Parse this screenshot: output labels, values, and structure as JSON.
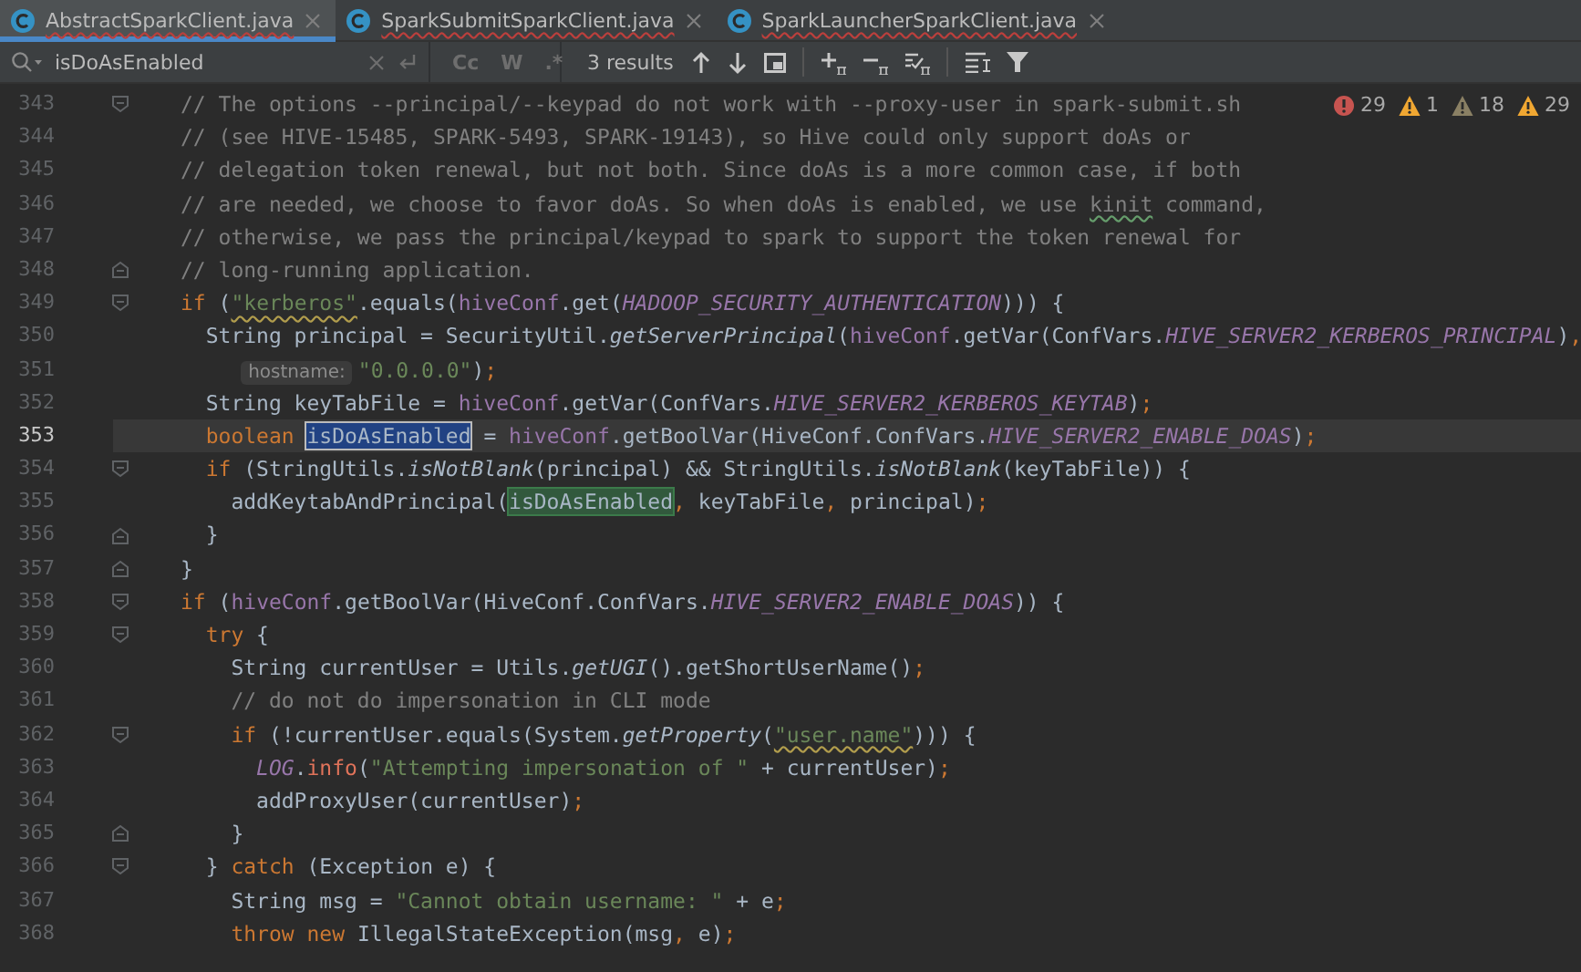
{
  "tabs": [
    {
      "label": "AbstractSparkClient.java",
      "selected": true
    },
    {
      "label": "SparkSubmitSparkClient.java",
      "selected": false
    },
    {
      "label": "SparkLauncherSparkClient.java",
      "selected": false
    }
  ],
  "search": {
    "value": "isDoAsEnabled",
    "options": [
      {
        "label": "Cc",
        "selected": false
      },
      {
        "label": "W",
        "selected": false
      },
      {
        "label": ".*",
        "selected": false
      }
    ],
    "results": "3 results"
  },
  "inspections": [
    {
      "kind": "error",
      "count": "29"
    },
    {
      "kind": "warning",
      "count": "1"
    },
    {
      "kind": "weak",
      "count": "18"
    },
    {
      "kind": "warning",
      "count": "29"
    }
  ],
  "lines": [
    {
      "number": "343",
      "kind": "fold-start",
      "current": false,
      "tokens": [
        {
          "kind": "comment",
          "text": "// The options --principal/--keypad do not work with --proxy-user in spark-submit.sh"
        }
      ]
    },
    {
      "number": "344",
      "kind": "code",
      "current": false,
      "tokens": [
        {
          "kind": "comment",
          "text": "// (see HIVE-15485, SPARK-5493, SPARK-19143), so Hive could only support doAs or"
        }
      ]
    },
    {
      "number": "345",
      "kind": "code",
      "current": false,
      "tokens": [
        {
          "kind": "comment",
          "text": "// delegation token renewal, but not both. Since doAs is a more common case, if both"
        }
      ]
    },
    {
      "number": "346",
      "kind": "code",
      "current": false,
      "tokens": [
        {
          "kind": "comment",
          "text": "// are needed, we choose to favor doAs. So when doAs is enabled, we use "
        },
        {
          "kind": "comment-typo",
          "text": "kinit"
        },
        {
          "kind": "comment",
          "text": " command,"
        }
      ]
    },
    {
      "number": "347",
      "kind": "code",
      "current": false,
      "tokens": [
        {
          "kind": "comment",
          "text": "// otherwise, we pass the principal/keypad to spark to support the token renewal for"
        }
      ]
    },
    {
      "number": "348",
      "kind": "fold-end",
      "current": false,
      "tokens": [
        {
          "kind": "comment",
          "text": "// long-running application."
        }
      ]
    },
    {
      "number": "349",
      "kind": "fold-start",
      "current": false,
      "tokens": [
        {
          "kind": "keyword",
          "text": "if"
        },
        {
          "kind": "plain",
          "text": " ("
        },
        {
          "kind": "string-typo",
          "text": "\"kerberos\""
        },
        {
          "kind": "plain",
          "text": ".equals("
        },
        {
          "kind": "field",
          "text": "hiveConf"
        },
        {
          "kind": "plain",
          "text": ".get("
        },
        {
          "kind": "constant",
          "text": "HADOOP_SECURITY_AUTHENTICATION"
        },
        {
          "kind": "plain",
          "text": "))) {"
        }
      ]
    },
    {
      "number": "350",
      "kind": "code",
      "current": false,
      "tokens": [
        {
          "kind": "plain",
          "text": "  String principal = SecurityUtil."
        },
        {
          "kind": "static",
          "text": "getServerPrincipal"
        },
        {
          "kind": "plain",
          "text": "("
        },
        {
          "kind": "field",
          "text": "hiveConf"
        },
        {
          "kind": "plain",
          "text": ".getVar(ConfVars."
        },
        {
          "kind": "constant",
          "text": "HIVE_SERVER2_KERBEROS_PRINCIPAL"
        },
        {
          "kind": "plain",
          "text": ")"
        },
        {
          "kind": "punct",
          "text": ","
        }
      ]
    },
    {
      "number": "351",
      "kind": "code",
      "current": false,
      "tokens": [
        {
          "kind": "hint",
          "text": "hostname:"
        },
        {
          "kind": "string",
          "text": "\"0.0.0.0\""
        },
        {
          "kind": "plain",
          "text": ")"
        },
        {
          "kind": "punct",
          "text": ";"
        }
      ]
    },
    {
      "number": "352",
      "kind": "code",
      "current": false,
      "tokens": [
        {
          "kind": "plain",
          "text": "  String keyTabFile = "
        },
        {
          "kind": "field",
          "text": "hiveConf"
        },
        {
          "kind": "plain",
          "text": ".getVar(ConfVars."
        },
        {
          "kind": "constant",
          "text": "HIVE_SERVER2_KERBEROS_KEYTAB"
        },
        {
          "kind": "plain",
          "text": ")"
        },
        {
          "kind": "punct",
          "text": ";"
        }
      ]
    },
    {
      "number": "353",
      "kind": "code",
      "current": true,
      "tokens": [
        {
          "kind": "keyword",
          "text": "  boolean "
        },
        {
          "kind": "selected-match",
          "text": "isDoAsEnabled"
        },
        {
          "kind": "plain",
          "text": " = "
        },
        {
          "kind": "field",
          "text": "hiveConf"
        },
        {
          "kind": "plain",
          "text": ".getBoolVar(HiveConf.ConfVars."
        },
        {
          "kind": "constant",
          "text": "HIVE_SERVER2_ENABLE_DOAS"
        },
        {
          "kind": "plain",
          "text": ")"
        },
        {
          "kind": "punct",
          "text": ";"
        }
      ]
    },
    {
      "number": "354",
      "kind": "fold-start",
      "current": false,
      "tokens": [
        {
          "kind": "keyword",
          "text": "  if"
        },
        {
          "kind": "plain",
          "text": " (StringUtils."
        },
        {
          "kind": "static",
          "text": "isNotBlank"
        },
        {
          "kind": "plain",
          "text": "(principal) && StringUtils."
        },
        {
          "kind": "static",
          "text": "isNotBlank"
        },
        {
          "kind": "plain",
          "text": "(keyTabFile)) {"
        }
      ]
    },
    {
      "number": "355",
      "kind": "code",
      "current": false,
      "tokens": [
        {
          "kind": "plain",
          "text": "    addKeytabAndPrincipal("
        },
        {
          "kind": "match",
          "text": "isDoAsEnabled"
        },
        {
          "kind": "punct",
          "text": ","
        },
        {
          "kind": "plain",
          "text": " keyTabFile"
        },
        {
          "kind": "punct",
          "text": ","
        },
        {
          "kind": "plain",
          "text": " principal)"
        },
        {
          "kind": "punct",
          "text": ";"
        }
      ]
    },
    {
      "number": "356",
      "kind": "fold-end",
      "current": false,
      "tokens": [
        {
          "kind": "plain",
          "text": "  }"
        }
      ]
    },
    {
      "number": "357",
      "kind": "fold-end",
      "current": false,
      "tokens": [
        {
          "kind": "plain",
          "text": "}"
        }
      ]
    },
    {
      "number": "358",
      "kind": "fold-start",
      "current": false,
      "tokens": [
        {
          "kind": "keyword",
          "text": "if"
        },
        {
          "kind": "plain",
          "text": " ("
        },
        {
          "kind": "field",
          "text": "hiveConf"
        },
        {
          "kind": "plain",
          "text": ".getBoolVar(HiveConf.ConfVars."
        },
        {
          "kind": "constant",
          "text": "HIVE_SERVER2_ENABLE_DOAS"
        },
        {
          "kind": "plain",
          "text": ")) {"
        }
      ]
    },
    {
      "number": "359",
      "kind": "fold-start",
      "current": false,
      "tokens": [
        {
          "kind": "keyword",
          "text": "  try"
        },
        {
          "kind": "plain",
          "text": " {"
        }
      ]
    },
    {
      "number": "360",
      "kind": "code",
      "current": false,
      "tokens": [
        {
          "kind": "plain",
          "text": "    String currentUser = Utils."
        },
        {
          "kind": "static",
          "text": "getUGI"
        },
        {
          "kind": "plain",
          "text": "().getShortUserName()"
        },
        {
          "kind": "punct",
          "text": ";"
        }
      ]
    },
    {
      "number": "361",
      "kind": "code",
      "current": false,
      "tokens": [
        {
          "kind": "comment",
          "text": "    // do not do impersonation in CLI mode"
        }
      ]
    },
    {
      "number": "362",
      "kind": "fold-start",
      "current": false,
      "tokens": [
        {
          "kind": "keyword",
          "text": "    if"
        },
        {
          "kind": "plain",
          "text": " (!currentUser.equals(System."
        },
        {
          "kind": "static",
          "text": "getProperty"
        },
        {
          "kind": "plain",
          "text": "("
        },
        {
          "kind": "string-typo",
          "text": "\"user.name\""
        },
        {
          "kind": "plain",
          "text": "))) {"
        }
      ]
    },
    {
      "number": "363",
      "kind": "code",
      "current": false,
      "tokens": [
        {
          "kind": "constant",
          "text": "      LOG"
        },
        {
          "kind": "plain",
          "text": "."
        },
        {
          "kind": "log-method",
          "text": "info"
        },
        {
          "kind": "plain",
          "text": "("
        },
        {
          "kind": "string",
          "text": "\"Attempting impersonation of \""
        },
        {
          "kind": "plain",
          "text": " + currentUser)"
        },
        {
          "kind": "punct",
          "text": ";"
        }
      ]
    },
    {
      "number": "364",
      "kind": "code",
      "current": false,
      "tokens": [
        {
          "kind": "plain",
          "text": "      addProxyUser(currentUser)"
        },
        {
          "kind": "punct",
          "text": ";"
        }
      ]
    },
    {
      "number": "365",
      "kind": "fold-end",
      "current": false,
      "tokens": [
        {
          "kind": "plain",
          "text": "    }"
        }
      ]
    },
    {
      "number": "366",
      "kind": "fold-start",
      "current": false,
      "tokens": [
        {
          "kind": "plain",
          "text": "  } "
        },
        {
          "kind": "keyword",
          "text": "catch"
        },
        {
          "kind": "plain",
          "text": " (Exception e) {"
        }
      ]
    },
    {
      "number": "367",
      "kind": "code",
      "current": false,
      "tokens": [
        {
          "kind": "plain",
          "text": "    String msg = "
        },
        {
          "kind": "string",
          "text": "\"Cannot obtain username: \""
        },
        {
          "kind": "plain",
          "text": " + e"
        },
        {
          "kind": "punct",
          "text": ";"
        }
      ]
    },
    {
      "number": "368",
      "kind": "code",
      "current": false,
      "tokens": [
        {
          "kind": "keyword",
          "text": "    throw new"
        },
        {
          "kind": "plain",
          "text": " IllegalStateException(msg"
        },
        {
          "kind": "punct",
          "text": ","
        },
        {
          "kind": "plain",
          "text": " e)"
        },
        {
          "kind": "punct",
          "text": ";"
        }
      ]
    }
  ]
}
